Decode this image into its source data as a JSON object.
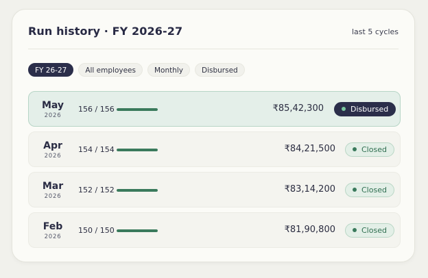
{
  "header": {
    "title": "Run history · FY 2026-27",
    "subtitle": "last 5 cycles"
  },
  "filters": [
    {
      "label": "FY 26-27",
      "active": true
    },
    {
      "label": "All employees",
      "active": false
    },
    {
      "label": "Monthly",
      "active": false
    },
    {
      "label": "Disbursed",
      "active": false
    }
  ],
  "rows": [
    {
      "month": "May",
      "year": "2026",
      "count": "156 / 156",
      "progress": 1.0,
      "amount": "₹85,42,300",
      "status": "Disbursed"
    },
    {
      "month": "Apr",
      "year": "2026",
      "count": "154 / 154",
      "progress": 1.0,
      "amount": "₹84,21,500",
      "status": "Closed"
    },
    {
      "month": "Mar",
      "year": "2026",
      "count": "152 / 152",
      "progress": 1.0,
      "amount": "₹83,14,200",
      "status": "Closed"
    },
    {
      "month": "Feb",
      "year": "2026",
      "count": "150 / 150",
      "progress": 1.0,
      "amount": "₹81,90,800",
      "status": "Closed"
    }
  ],
  "colors": {
    "navy": "#2b2e4a",
    "green": "#3a7a5c",
    "current_row_bg": "#e4efe9"
  }
}
